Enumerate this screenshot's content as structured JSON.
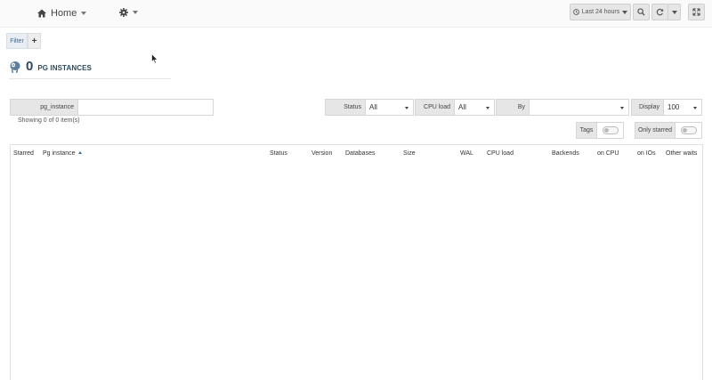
{
  "topbar": {
    "home_label": "Home",
    "home_icon": "home-icon",
    "settings_icon": "gear-icon",
    "time_range_label": "Last 24 hours",
    "zoom_icon": "search-icon",
    "refresh_icon": "refresh-icon",
    "fullscreen_icon": "expand-icon"
  },
  "filter_bar": {
    "filter_tab_label": "Filter",
    "add_label": "+"
  },
  "summary": {
    "count": "0",
    "label": "PG INSTANCES"
  },
  "filters": {
    "pg_instance_label": "pg_instance",
    "pg_instance_value": "",
    "status_label": "Status",
    "status_value": "All",
    "cpu_load_label": "CPU load",
    "cpu_load_value": "All",
    "by_label": "By",
    "by_value": "",
    "display_label": "Display",
    "display_value": "100",
    "tags_label": "Tags",
    "only_starred_label": "Only starred"
  },
  "showing_text": "Showing 0 of 0 item(s)",
  "table": {
    "columns": [
      "Starred",
      "Pg instance",
      "Status",
      "Version",
      "Databases",
      "Size",
      "WAL",
      "CPU load",
      "Backends",
      "on CPU",
      "on IOs",
      "Other waits"
    ],
    "sorted_column": "Pg instance",
    "sort_direction": "ascending",
    "rows": []
  },
  "colors": {
    "accent": "#3a6c93",
    "title": "#2b4a62"
  }
}
